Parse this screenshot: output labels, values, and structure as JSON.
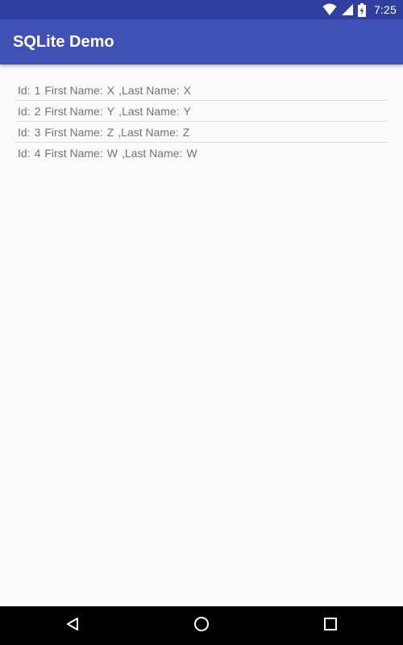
{
  "status_bar": {
    "time": "7:25",
    "icons": [
      "wifi-icon",
      "cell-signal-icon",
      "battery-charging-icon"
    ]
  },
  "app_bar": {
    "title": "SQLite Demo"
  },
  "records": [
    {
      "id_label": "Id:",
      "id": "1",
      "first_label": "First Name:",
      "first": "X",
      "last_label": ",Last Name:",
      "last": "X"
    },
    {
      "id_label": "Id:",
      "id": "2",
      "first_label": "First Name:",
      "first": "Y",
      "last_label": ",Last Name:",
      "last": "Y"
    },
    {
      "id_label": "Id:",
      "id": "3",
      "first_label": "First Name:",
      "first": "Z",
      "last_label": ",Last Name:",
      "last": "Z"
    },
    {
      "id_label": "Id:",
      "id": "4",
      "first_label": "First Name:",
      "first": "W",
      "last_label": ",Last Name:",
      "last": "W"
    }
  ],
  "nav_bar": {
    "buttons": [
      "back-icon",
      "home-icon",
      "recents-icon"
    ]
  },
  "colors": {
    "status_bar": "#303f9f",
    "app_bar": "#3f51b5",
    "background": "#fafafa",
    "text": "#737373"
  }
}
